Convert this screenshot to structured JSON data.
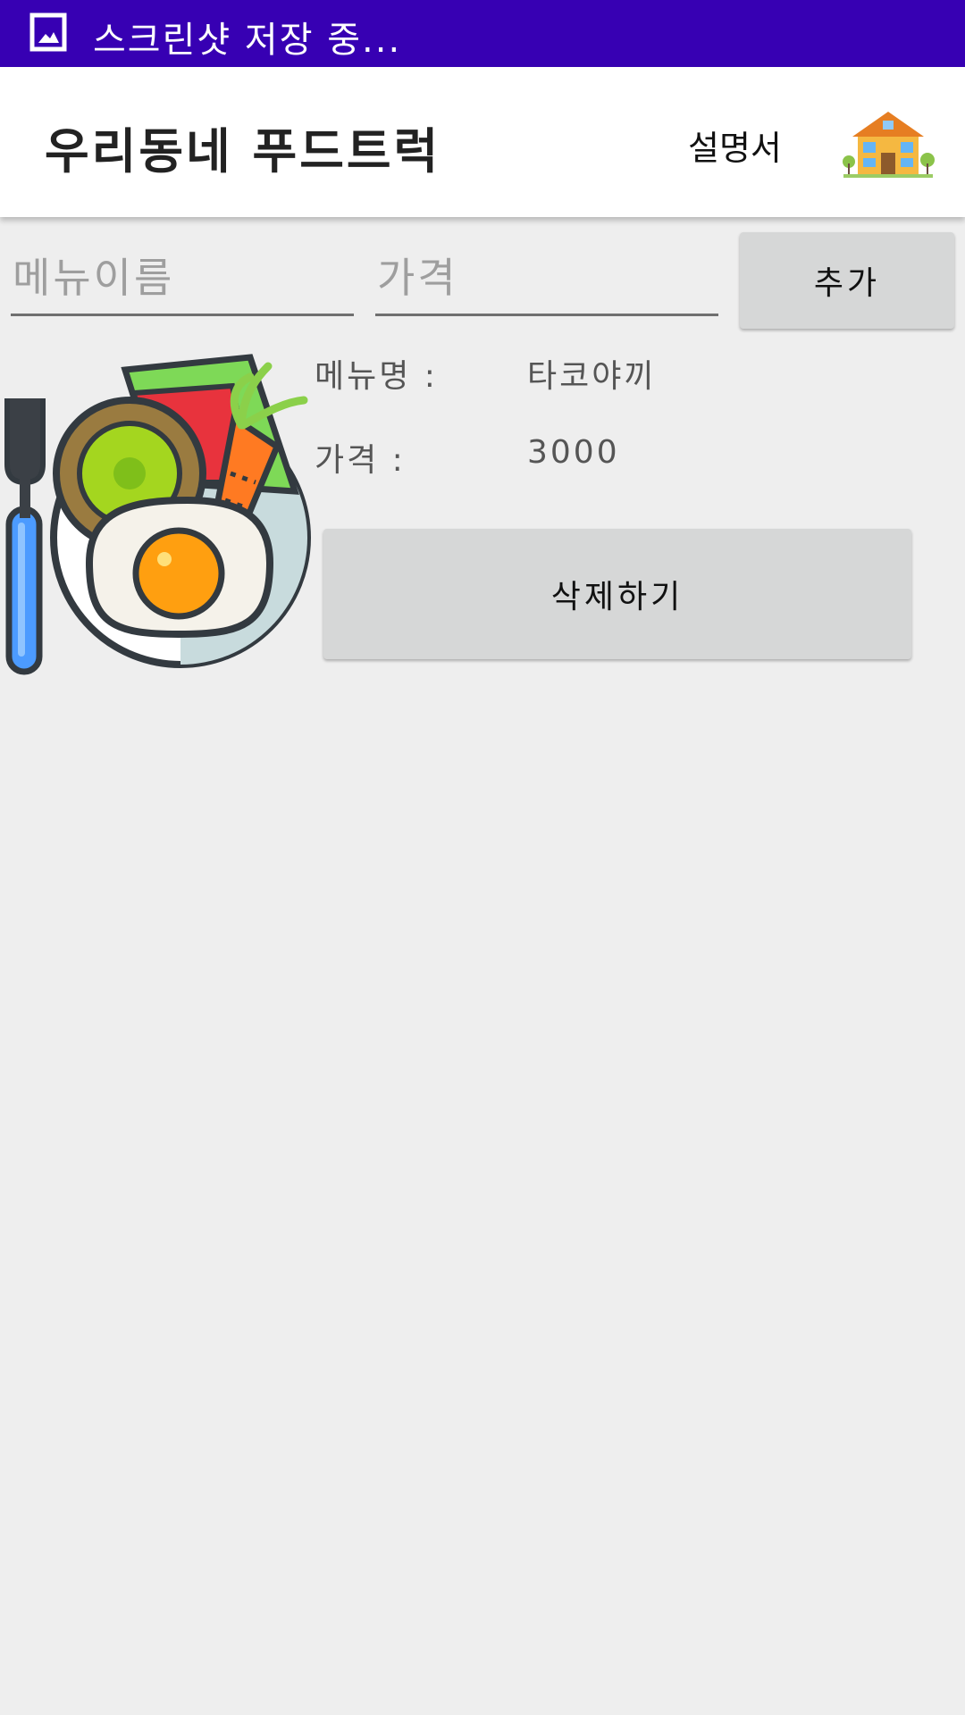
{
  "status_bar": {
    "icon": "screenshot-image-icon",
    "text": "스크린샷 저장 중..."
  },
  "app_bar": {
    "title": "우리동네 푸드트럭",
    "manual_label": "설명서",
    "home_icon": "house-icon"
  },
  "form": {
    "menu_name": {
      "value": "",
      "placeholder": "메뉴이름"
    },
    "price": {
      "value": "",
      "placeholder": "가격"
    },
    "add_label": "추가"
  },
  "menu_items": [
    {
      "image_icon": "food-plate-icon",
      "name_label": "메뉴명 :",
      "name_value": "타코야끼",
      "price_label": "가격 :",
      "price_value": "3000",
      "delete_label": "삭제하기"
    }
  ],
  "colors": {
    "status_bar": "#3700b3",
    "app_bar": "#ffffff",
    "background": "#eeeeee",
    "button": "#d6d7d7"
  }
}
